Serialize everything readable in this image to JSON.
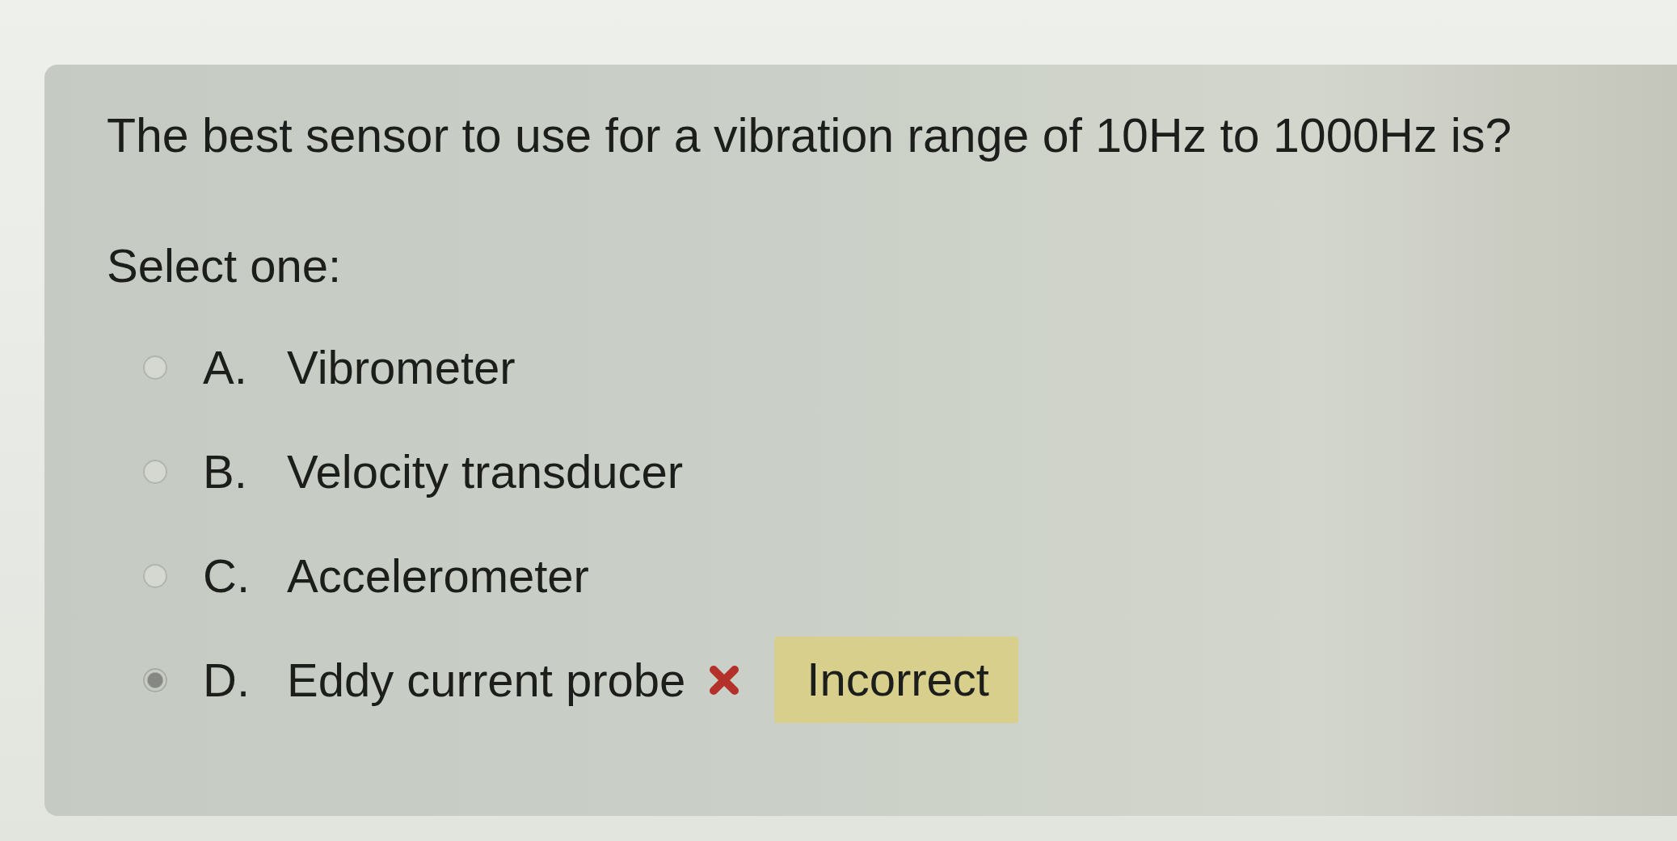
{
  "question": {
    "text": "The best sensor to use for a vibration range of 10Hz to 1000Hz is?"
  },
  "prompt": "Select one:",
  "options": [
    {
      "letter": "A.",
      "label": "Vibrometer",
      "selected": false
    },
    {
      "letter": "B.",
      "label": "Velocity transducer",
      "selected": false
    },
    {
      "letter": "C.",
      "label": "Accelerometer",
      "selected": false
    },
    {
      "letter": "D.",
      "label": "Eddy current probe",
      "selected": true,
      "feedback": {
        "kind": "incorrect",
        "text": "Incorrect"
      }
    }
  ]
}
